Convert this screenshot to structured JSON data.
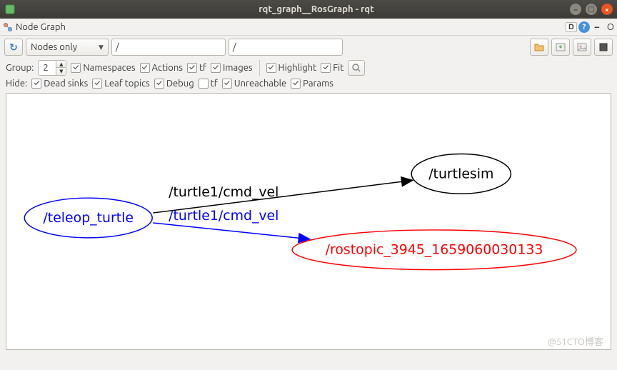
{
  "window": {
    "title": "rqt_graph__RosGraph - rqt"
  },
  "menubar": {
    "title": "Node Graph",
    "dq": "D",
    "o": "O"
  },
  "toolbar": {
    "mode": "Nodes only",
    "filter1": "/",
    "filter2": "/"
  },
  "group": {
    "label": "Group:",
    "value": "2",
    "namespaces": "Namespaces",
    "actions": "Actions",
    "tf": "tf",
    "images": "Images",
    "highlight": "Highlight",
    "fit": "Fit"
  },
  "hide": {
    "label": "Hide:",
    "dead": "Dead sinks",
    "leaf": "Leaf topics",
    "debug": "Debug",
    "tf": "tf",
    "unreachable": "Unreachable",
    "params": "Params"
  },
  "graph": {
    "nodes": {
      "teleop": "/teleop_turtle",
      "turtlesim": "/turtlesim",
      "rostopic": "/rostopic_3945_1659060030133"
    },
    "edges": {
      "e1": "/turtle1/cmd_vel",
      "e2": "/turtle1/cmd_vel"
    }
  },
  "watermark": "@51CTO博客"
}
